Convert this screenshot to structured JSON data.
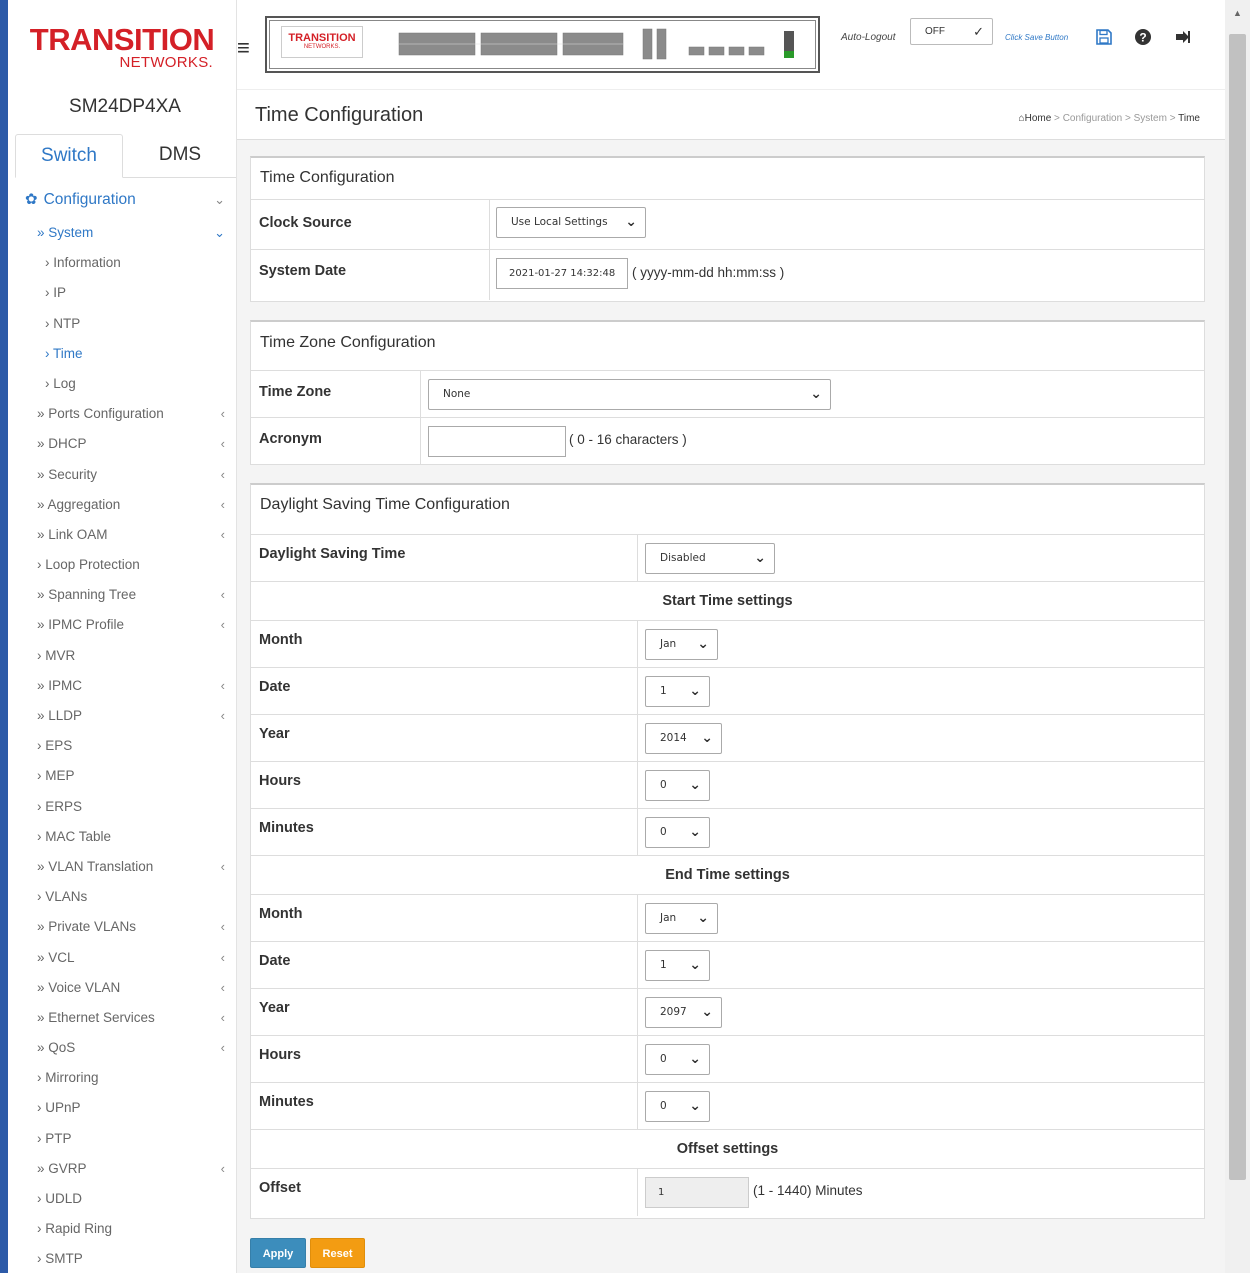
{
  "sidebar": {
    "logo_top": "TRANSITION",
    "logo_bottom": "NETWORKS.",
    "model": "SM24DP4XA",
    "tabs": [
      "Switch",
      "DMS"
    ],
    "configuration": "Configuration",
    "system": "» System",
    "system_items": [
      "› Information",
      "› IP",
      "› NTP",
      "› Time",
      "› Log"
    ],
    "items": [
      {
        "label": "» Ports Configuration",
        "arrow": "‹"
      },
      {
        "label": "» DHCP",
        "arrow": "‹"
      },
      {
        "label": "» Security",
        "arrow": "‹"
      },
      {
        "label": "» Aggregation",
        "arrow": "‹"
      },
      {
        "label": "» Link OAM",
        "arrow": "‹"
      },
      {
        "label": "› Loop Protection",
        "arrow": ""
      },
      {
        "label": "» Spanning Tree",
        "arrow": "‹"
      },
      {
        "label": "» IPMC Profile",
        "arrow": "‹"
      },
      {
        "label": "› MVR",
        "arrow": ""
      },
      {
        "label": "» IPMC",
        "arrow": "‹"
      },
      {
        "label": "» LLDP",
        "arrow": "‹"
      },
      {
        "label": "› EPS",
        "arrow": ""
      },
      {
        "label": "› MEP",
        "arrow": ""
      },
      {
        "label": "› ERPS",
        "arrow": ""
      },
      {
        "label": "› MAC Table",
        "arrow": ""
      },
      {
        "label": "» VLAN Translation",
        "arrow": "‹"
      },
      {
        "label": "› VLANs",
        "arrow": ""
      },
      {
        "label": "» Private VLANs",
        "arrow": "‹"
      },
      {
        "label": "» VCL",
        "arrow": "‹"
      },
      {
        "label": "» Voice VLAN",
        "arrow": "‹"
      },
      {
        "label": "» Ethernet Services",
        "arrow": "‹"
      },
      {
        "label": "» QoS",
        "arrow": "‹"
      },
      {
        "label": "› Mirroring",
        "arrow": ""
      },
      {
        "label": "› UPnP",
        "arrow": ""
      },
      {
        "label": "› PTP",
        "arrow": ""
      },
      {
        "label": "» GVRP",
        "arrow": "‹"
      },
      {
        "label": "› UDLD",
        "arrow": ""
      },
      {
        "label": "› Rapid Ring",
        "arrow": ""
      },
      {
        "label": "› SMTP",
        "arrow": ""
      }
    ]
  },
  "header": {
    "panel_logo_top": "TRANSITION",
    "panel_logo_bottom": "NETWORKS.",
    "auto_logout_label": "Auto-Logout",
    "auto_logout_value": "OFF",
    "save_link": "Click Save Button"
  },
  "page": {
    "title": "Time Configuration",
    "breadcrumb": {
      "home": "Home",
      "sep": " > ",
      "configuration": "Configuration",
      "system": "System",
      "current": "Time"
    }
  },
  "time_config": {
    "title": "Time Configuration",
    "clock_source_label": "Clock Source",
    "clock_source_value": "Use Local Settings",
    "system_date_label": "System Date",
    "system_date_value": "2021-01-27 14:32:48",
    "system_date_hint": "( yyyy-mm-dd hh:mm:ss )"
  },
  "tz_config": {
    "title": "Time Zone Configuration",
    "time_zone_label": "Time Zone",
    "time_zone_value": "None",
    "acronym_label": "Acronym",
    "acronym_value": "",
    "acronym_hint": "( 0 - 16 characters )"
  },
  "dst_config": {
    "title": "Daylight Saving Time Configuration",
    "dst_label": "Daylight Saving Time",
    "dst_value": "Disabled",
    "start_heading": "Start Time settings",
    "end_heading": "End Time settings",
    "offset_heading": "Offset settings",
    "labels": {
      "month": "Month",
      "date": "Date",
      "year": "Year",
      "hours": "Hours",
      "minutes": "Minutes",
      "offset": "Offset"
    },
    "start": {
      "month": "Jan",
      "date": "1",
      "year": "2014",
      "hours": "0",
      "minutes": "0"
    },
    "end": {
      "month": "Jan",
      "date": "1",
      "year": "2097",
      "hours": "0",
      "minutes": "0"
    },
    "offset_value": "1",
    "offset_hint": "(1 - 1440) Minutes"
  },
  "buttons": {
    "apply": "Apply",
    "reset": "Reset"
  }
}
